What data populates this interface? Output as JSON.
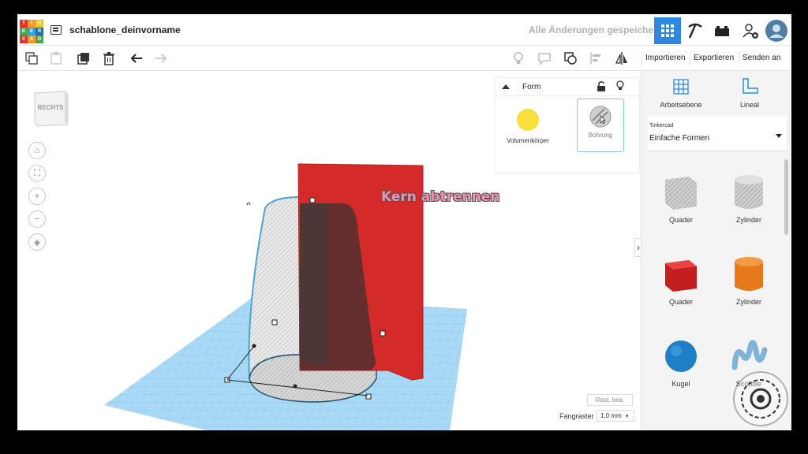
{
  "header": {
    "logo_letters": [
      "TIN",
      "KER",
      "CAD"
    ],
    "document_name": "schablone_deinvorname",
    "save_status": "Alle Änderungen gespeichert"
  },
  "toolbar": {
    "import_label": "Importieren",
    "export_label": "Exportieren",
    "send_label": "Senden an"
  },
  "viewcube": {
    "face_label": "RECHTS"
  },
  "annotation": {
    "text": "Kern abtrennen"
  },
  "shape_panel": {
    "title": "Form",
    "solid_label": "Volumenkörper",
    "hole_label": "Bohrung",
    "solid_color": "#f7e03c"
  },
  "right_panel": {
    "workplane_label": "Arbeitsebene",
    "ruler_label": "Lineal",
    "library_source": "Tinkercad",
    "library_selected": "Einfache Formen",
    "shapes": [
      {
        "label": "Quader",
        "kind": "box-hole"
      },
      {
        "label": "Zylinder",
        "kind": "cylinder-hole"
      },
      {
        "label": "Quader",
        "kind": "box-red"
      },
      {
        "label": "Zylinder",
        "kind": "cylinder-orange"
      },
      {
        "label": "Kugel",
        "kind": "sphere-blue"
      },
      {
        "label": "Scribble",
        "kind": "scribble"
      }
    ]
  },
  "bottom": {
    "edit_grid_label": "Rast. bea.",
    "snap_label": "Fangraster",
    "snap_value": "1,0 mm"
  },
  "colors": {
    "accent_blue": "#2d88e0",
    "red_box": "#d42a2a",
    "workplane": "#a9d9f5"
  }
}
